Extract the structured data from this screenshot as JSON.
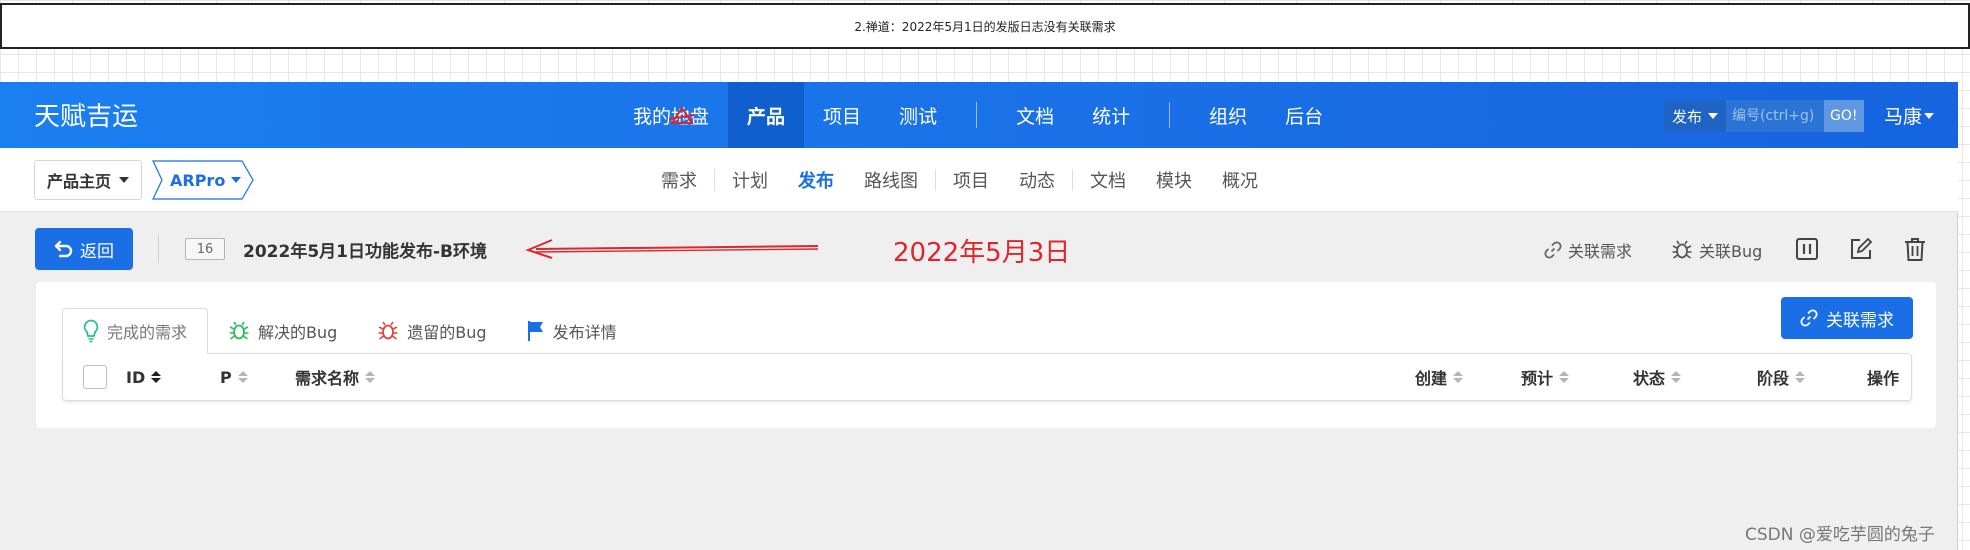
{
  "caption": "2.禅道：2022年5月1日的发版日志没有关联需求",
  "topbar": {
    "brand": "天赋吉运",
    "nav": [
      "我的地盘",
      "产品",
      "项目",
      "测试",
      "文档",
      "统计",
      "组织",
      "后台"
    ],
    "active_nav": "产品",
    "search_type": "发布",
    "search_placeholder": "编号(ctrl+g)",
    "go_label": "GO!",
    "user": "马康"
  },
  "subbar": {
    "crumb_home": "产品主页",
    "crumb_product": "ARPro",
    "nav": [
      "需求",
      "计划",
      "发布",
      "路线图",
      "项目",
      "动态",
      "文档",
      "模块",
      "概况"
    ],
    "active_nav": "发布"
  },
  "toolbar": {
    "back_label": "返回",
    "release_id": "16",
    "release_title": "2022年5月1日功能发布-B环境",
    "annotation_date": "2022年5月3日",
    "link_story": "关联需求",
    "link_bug": "关联Bug"
  },
  "panel": {
    "tabs": [
      "完成的需求",
      "解决的Bug",
      "遗留的Bug",
      "发布详情"
    ],
    "active_tab": "完成的需求",
    "link_story_button": "关联需求",
    "columns": [
      "ID",
      "P",
      "需求名称",
      "创建",
      "预计",
      "状态",
      "阶段",
      "操作"
    ]
  },
  "colors": {
    "primary": "#1a6fe6",
    "annotation_red": "#e0262c",
    "story_icon": "#2bbf8a",
    "bug_green": "#2bbf5a",
    "bug_red": "#e0473b",
    "flag_blue": "#1a6fe6"
  },
  "watermark": "CSDN @爱吃芋圆的兔子"
}
